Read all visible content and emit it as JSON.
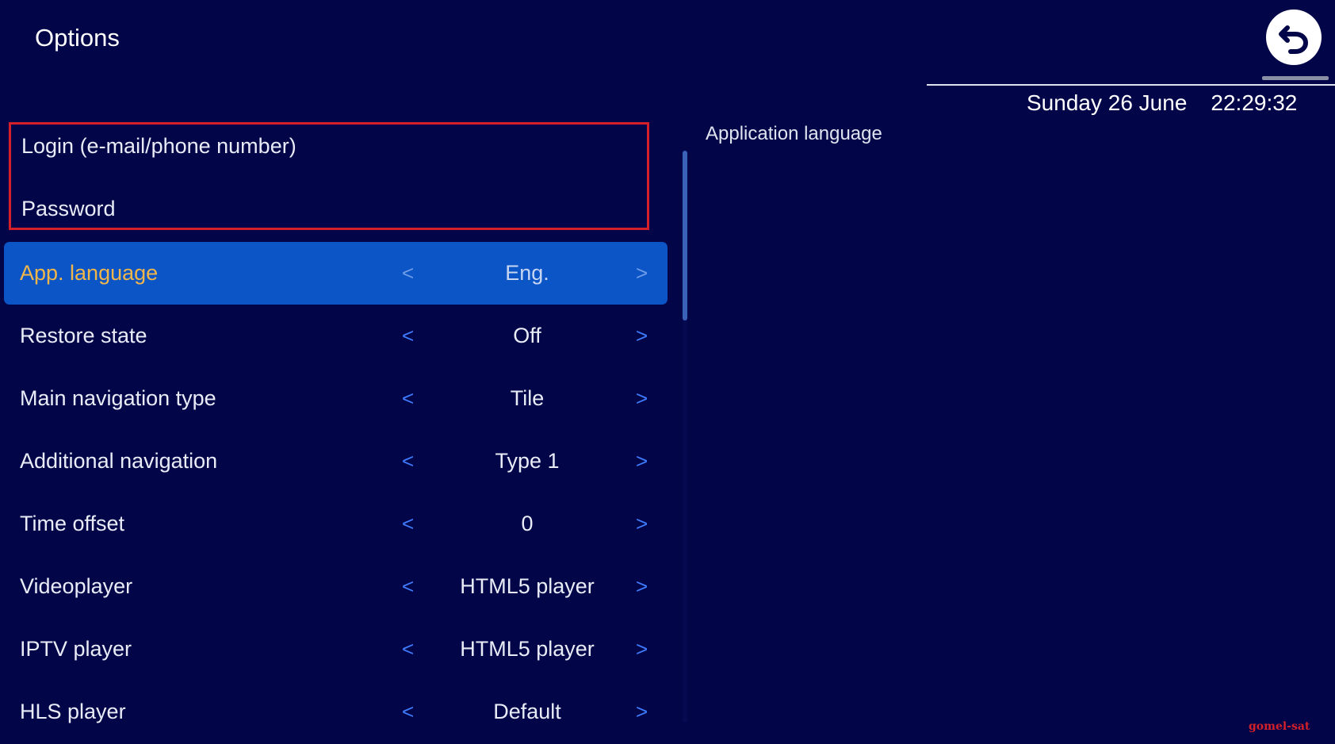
{
  "header": {
    "title": "Options",
    "date": "Sunday 26 June",
    "time": "22:29:32",
    "back_icon": "back-arrow-icon"
  },
  "credentials": {
    "login_label": "Login (e-mail/phone number)",
    "password_label": "Password"
  },
  "arrows": {
    "left": "<",
    "right": ">"
  },
  "settings": [
    {
      "label": "App. language",
      "value": "Eng.",
      "selected": true
    },
    {
      "label": "Restore state",
      "value": "Off"
    },
    {
      "label": "Main navigation type",
      "value": "Tile"
    },
    {
      "label": "Additional navigation",
      "value": "Type 1"
    },
    {
      "label": "Time offset",
      "value": "0"
    },
    {
      "label": "Videoplayer",
      "value": "HTML5 player"
    },
    {
      "label": "IPTV player",
      "value": "HTML5 player"
    },
    {
      "label": "HLS player",
      "value": "Default"
    }
  ],
  "description": {
    "text": "Application language"
  },
  "watermark": "gomel-sat",
  "colors": {
    "background": "#020648",
    "selected_row": "#0b55c6",
    "selected_label": "#f1b64a",
    "arrow": "#3f7bff",
    "highlight_border": "#d3202a"
  }
}
